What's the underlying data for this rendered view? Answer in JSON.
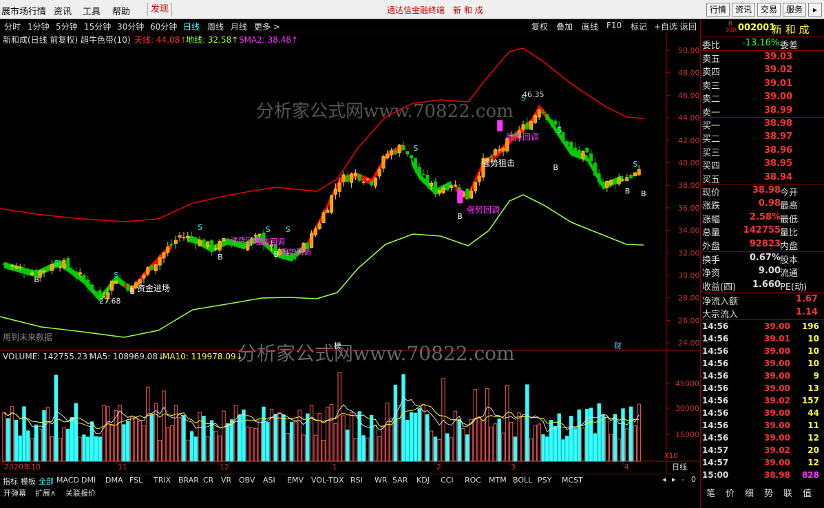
{
  "menu": {
    "items": [
      "展市场行情",
      "资讯",
      "工具",
      "帮助",
      "发现"
    ],
    "center_title": "通达信金融终端　新 和 成",
    "right_buttons": [
      "行情",
      "资讯",
      "交易",
      "服务"
    ]
  },
  "periods": {
    "items": [
      "分时",
      "1分钟",
      "5分钟",
      "15分钟",
      "30分钟",
      "60分钟",
      "日线",
      "周线",
      "月线",
      "更多 >"
    ],
    "active": "日线"
  },
  "toolbar": {
    "items": [
      "复权",
      "叠加",
      "画线",
      "F10",
      "标记",
      "+自选",
      "返回"
    ]
  },
  "main_panel": {
    "title": "新和成(日线 前复权) 超牛色带(10)",
    "tianxian": "天线: 44.08↑",
    "dixian": "地线: 32.58↑",
    "sma2": "SMA2: 38.48↑",
    "watermark": "分析家公式网www.70822.com",
    "future_note": "用到未来数据",
    "bang_marker": "榜",
    "cai_marker": "财"
  },
  "annotations": {
    "high": "46.35",
    "low": "27.68",
    "zijin": "资金进场",
    "qsjj": "强势狙击",
    "qshd1": "强势回调",
    "qshd2": "强势回调",
    "qshd3": "强势回调",
    "qshd4": "强势回调",
    "qshd5": "强势回调",
    "s": "S",
    "b": "B"
  },
  "price_axis": [
    "50.00",
    "48.00",
    "46.00",
    "44.00",
    "42.00",
    "40.00",
    "38.00",
    "36.00",
    "34.00",
    "32.00",
    "30.00",
    "28.00",
    "26.00",
    "24.00"
  ],
  "volume_panel": {
    "volume": "VOLUME: 142755.23↑",
    "ma5": "MA5: 108969.08↓",
    "ma10": "MA10: 119978.09↓",
    "watermark": "分析家公式网www.70822.com",
    "axis": [
      "45000",
      "30000",
      "15000"
    ],
    "unit": "X10"
  },
  "date_axis": [
    "2020年10",
    "11",
    "12",
    "1",
    "2",
    "3",
    "4"
  ],
  "date_axis_right": "日线",
  "indicator_tabs": [
    "指标",
    "模板",
    "全部",
    "MACD",
    "DMI",
    "DMA",
    "FSL",
    "TRIX",
    "BRAR",
    "CR",
    "VR",
    "OBV",
    "ASI",
    "EMV",
    "VOL-TDX",
    "RSI",
    "WR",
    "SAR",
    "KDJ",
    "CCI",
    "ROC",
    "MTM",
    "BOLL",
    "PSY",
    "MCST"
  ],
  "indicator_active": "全部",
  "footer": {
    "items": [
      "开弹幕",
      "扩展∧",
      "关联报价"
    ],
    "controls": [
      "◂",
      "▸",
      "-",
      "0"
    ]
  },
  "quote": {
    "badge_r": "R",
    "badge_num": "300",
    "code": "002001",
    "name": "新 和 成",
    "weibi_label": "委比",
    "weibi": "-13.16%",
    "weicha_label": "委差",
    "asks": [
      {
        "label": "卖五",
        "price": "39.03"
      },
      {
        "label": "卖四",
        "price": "39.02"
      },
      {
        "label": "卖三",
        "price": "39.01"
      },
      {
        "label": "卖二",
        "price": "39.00"
      },
      {
        "label": "卖一",
        "price": "38.99"
      }
    ],
    "bids": [
      {
        "label": "买一",
        "price": "38.98"
      },
      {
        "label": "买二",
        "price": "38.97"
      },
      {
        "label": "买三",
        "price": "38.96"
      },
      {
        "label": "买四",
        "price": "38.95"
      },
      {
        "label": "买五",
        "price": "38.94"
      }
    ],
    "stats": [
      {
        "l": "现价",
        "v": "38.98",
        "r": "今开"
      },
      {
        "l": "涨跌",
        "v": "0.98",
        "r": "最高"
      },
      {
        "l": "涨幅",
        "v": "2.58%",
        "r": "最低"
      },
      {
        "l": "总量",
        "v": "142755",
        "r": "量比"
      },
      {
        "l": "外盘",
        "v": "92823",
        "r": "内盘"
      }
    ],
    "stats2": [
      {
        "l": "换手",
        "v": "0.67%",
        "r": "股本"
      },
      {
        "l": "净资",
        "v": "9.00",
        "r": "流通"
      },
      {
        "l": "收益(四)",
        "v": "1.660",
        "r": "PE(动)"
      }
    ],
    "flow": [
      {
        "l": "净流入额",
        "v": "1.67"
      },
      {
        "l": "大宗流入",
        "v": "1.14"
      }
    ],
    "ticks": [
      {
        "t": "14:56",
        "p": "39.00",
        "v": "196"
      },
      {
        "t": "14:56",
        "p": "39.01",
        "v": "10"
      },
      {
        "t": "14:56",
        "p": "39.00",
        "v": "10"
      },
      {
        "t": "14:56",
        "p": "39.00",
        "v": "10"
      },
      {
        "t": "14:56",
        "p": "39.00",
        "v": "9"
      },
      {
        "t": "14:56",
        "p": "39.00",
        "v": "13"
      },
      {
        "t": "14:56",
        "p": "39.02",
        "v": "157"
      },
      {
        "t": "14:56",
        "p": "39.00",
        "v": "44"
      },
      {
        "t": "14:56",
        "p": "39.00",
        "v": "11"
      },
      {
        "t": "14:56",
        "p": "39.00",
        "v": "12"
      },
      {
        "t": "14:57",
        "p": "39.02",
        "v": "20"
      },
      {
        "t": "14:57",
        "p": "39.00",
        "v": "12"
      },
      {
        "t": "15:00",
        "p": "38.98",
        "v": "828"
      }
    ],
    "tabs": [
      "笔",
      "价",
      "细",
      "势",
      "联",
      "值"
    ]
  },
  "colors": {
    "up": "#ff3333",
    "down": "#00dd00",
    "cyan": "#33ffff",
    "yellow": "#ffff33",
    "magenta": "#ff33ff",
    "ask_price": "#ff3333",
    "bid_price": "#ff3333"
  }
}
